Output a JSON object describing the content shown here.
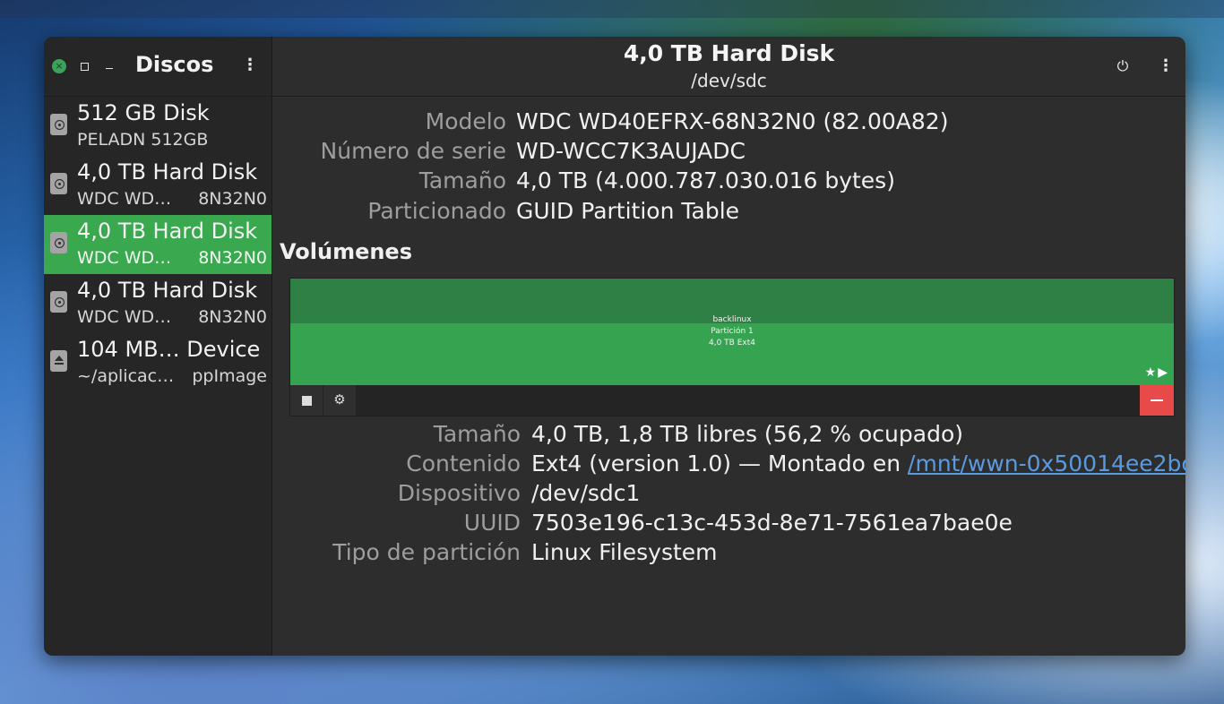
{
  "sidebar": {
    "title": "Discos",
    "disks": [
      {
        "name": "512 GB Disk",
        "sub": "PELADN 512GB",
        "sub_right": "",
        "icon": "hard-disk-icon",
        "selected": false
      },
      {
        "name": "4,0 TB Hard Disk",
        "sub": "WDC WD…",
        "sub_right": "8N32N0",
        "icon": "hard-disk-icon",
        "selected": false
      },
      {
        "name": "4,0 TB Hard Disk",
        "sub": "WDC WD…",
        "sub_right": "8N32N0",
        "icon": "hard-disk-icon",
        "selected": true
      },
      {
        "name": "4,0 TB Hard Disk",
        "sub": "WDC WD…",
        "sub_right": "8N32N0",
        "icon": "hard-disk-icon",
        "selected": false
      },
      {
        "name": "104 MB… Device",
        "sub": "~/aplicac…",
        "sub_right": "ppImage",
        "icon": "eject-icon",
        "selected": false
      }
    ]
  },
  "header": {
    "title": "4,0 TB Hard Disk",
    "subtitle": "/dev/sdc"
  },
  "disk_info": {
    "model_label": "Modelo",
    "model_value": "WDC WD40EFRX-68N32N0 (82.00A82)",
    "serial_label": "Número de serie",
    "serial_value": "WD-WCC7K3AUJADC",
    "size_label": "Tamaño",
    "size_value": "4,0 TB (4.000.787.030.016 bytes)",
    "partitioning_label": "Particionado",
    "partitioning_value": "GUID Partition Table"
  },
  "volumes": {
    "title": "Volúmenes",
    "partition": {
      "name": "backlinux",
      "label": "Partición 1",
      "size_type": "4,0 TB Ext4"
    },
    "markers": "★▶"
  },
  "partition_info": {
    "size_label": "Tamaño",
    "size_value": "4,0 TB, 1,8 TB libres (56,2 % ocupado)",
    "content_label": "Contenido",
    "content_value": "Ext4 (version 1.0) — Montado en ",
    "content_link": "/mnt/wwn-0x50014ee2bc…",
    "device_label": "Dispositivo",
    "device_value": "/dev/sdc1",
    "uuid_label": "UUID",
    "uuid_value": "7503e196-c13c-453d-8e71-7561ea7bae0e",
    "type_label": "Tipo de partición",
    "type_value": "Linux Filesystem"
  },
  "icons": {
    "close": "×",
    "kebab": "⋮",
    "power": "⏻",
    "gears": "⚙"
  },
  "colors": {
    "accent": "#39a84e",
    "destructive": "#e84a4a",
    "link": "#5a9be0"
  }
}
